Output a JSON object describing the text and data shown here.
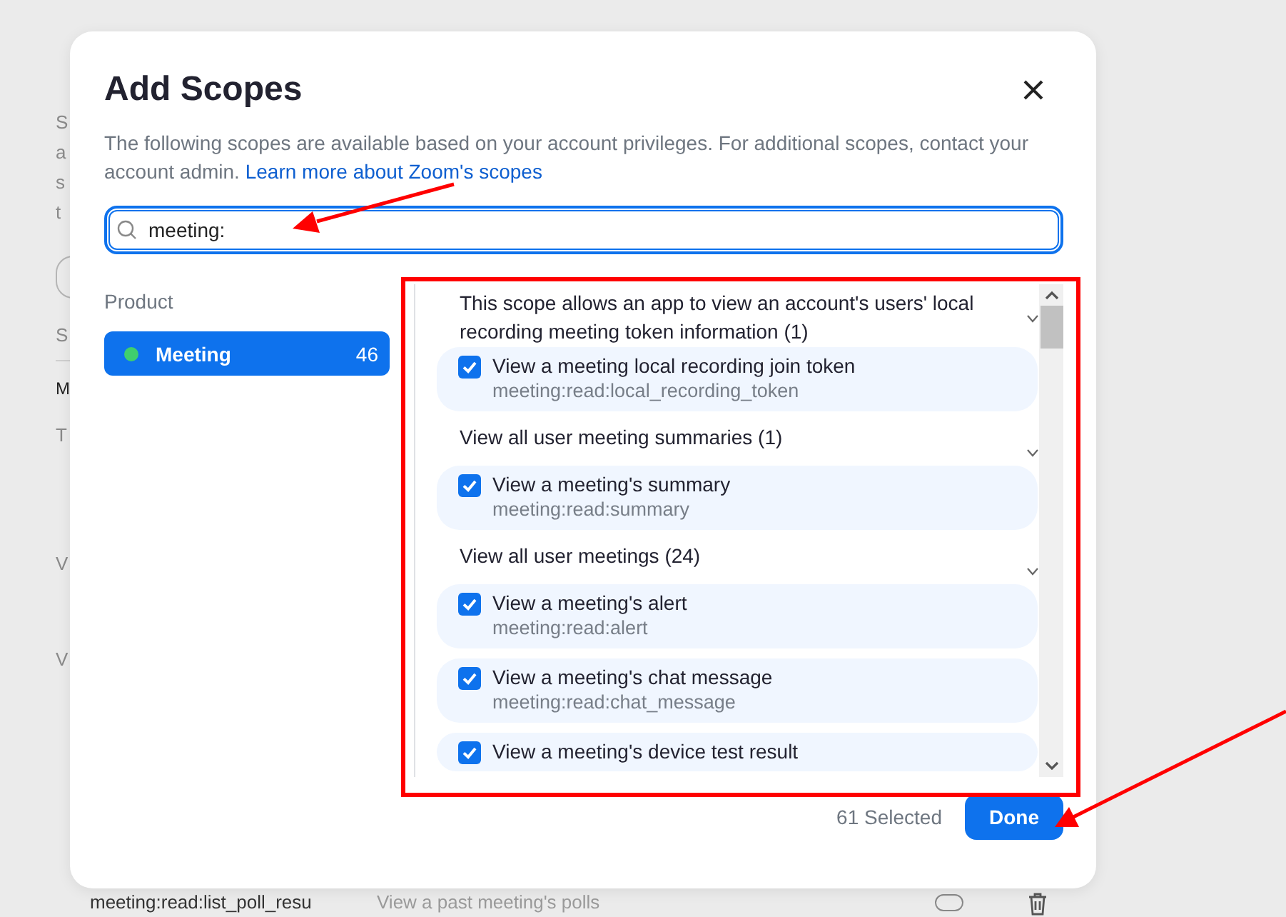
{
  "background_page": {
    "text_fragments": [
      "S",
      "a",
      "s",
      "t"
    ],
    "section_fragment": "S",
    "tab_fragment": "M",
    "note_fragment": "T",
    "row_fragments": [
      "V",
      "V"
    ],
    "bottom_row": {
      "scope": "meeting:read:list_poll_resu",
      "description": "View a past meeting's polls"
    }
  },
  "dialog": {
    "title": "Add Scopes",
    "description": "The following scopes are available based on your account privileges. For additional scopes, contact your account admin.",
    "link": "Learn more about Zoom's scopes",
    "search": {
      "value": "meeting:"
    },
    "products_heading": "Product",
    "products": [
      {
        "name": "Meeting",
        "count": "46",
        "selected": true
      }
    ],
    "groups": [
      {
        "title": "This scope allows an app to view an account's users' local recording meeting token information (1)",
        "expanded": true,
        "scopes": [
          {
            "label": "View a meeting local recording join token",
            "scope": "meeting:read:local_recording_token",
            "checked": true
          }
        ]
      },
      {
        "title": "View all user meeting summaries (1)",
        "expanded": true,
        "scopes": [
          {
            "label": "View a meeting's summary",
            "scope": "meeting:read:summary",
            "checked": true
          }
        ]
      },
      {
        "title": "View all user meetings (24)",
        "expanded": true,
        "scopes": [
          {
            "label": "View a meeting's alert",
            "scope": "meeting:read:alert",
            "checked": true
          },
          {
            "label": "View a meeting's chat message",
            "scope": "meeting:read:chat_message",
            "checked": true
          },
          {
            "label": "View a meeting's device test result",
            "checked": true
          }
        ]
      }
    ],
    "selected_count": "61 Selected",
    "done": "Done"
  }
}
